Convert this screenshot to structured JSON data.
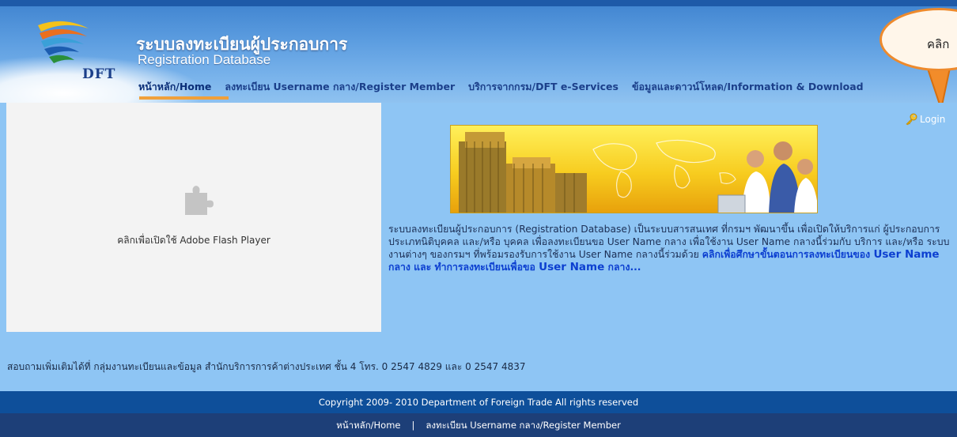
{
  "header": {
    "logo_text": "DFT",
    "title_th": "ระบบลงทะเบียนผู้ประกอบการ",
    "title_en": "Registration Database",
    "callout_text": "คลิก"
  },
  "nav": {
    "items": [
      {
        "label": "หน้าหลัก/Home"
      },
      {
        "label": "ลงทะเบียน Username กลาง/Register Member"
      },
      {
        "label": "บริการจากกรม/DFT e-Services"
      },
      {
        "label": "ข้อมูลและดาวน์โหลด/Information & Download"
      }
    ]
  },
  "main": {
    "flash_text": "คลิกเพื่อเปิดใช้ Adobe Flash Player",
    "login_label": "Login",
    "intro_text": "ระบบลงทะเบียนผู้ประกอบการ (Registration Database) เป็นระบบสารสนเทศ ที่กรมฯ พัฒนาขึ้น เพื่อเปิดให้บริการแก่ ผู้ประกอบการประเภทนิติบุคคล และ/หรือ บุคคล เพื่อลงทะเบียนขอ User Name กลาง เพื่อใช้งาน User Name กลางนี้ร่วมกับ บริการ และ/หรือ ระบบงานต่างๆ ของกรมฯ ที่พร้อมรองรับการใช้งาน User Name กลางนี้ร่วมด้วย ",
    "intro_link_1": "คลิกเพื่อศึกษาขั้นตอนการลงทะเบียนของ ",
    "intro_link_2": "User Name",
    "intro_link_3": " กลาง และ ทำการลงทะเบียนเพื่อขอ ",
    "intro_link_4": "User Name",
    "intro_link_5": " กลาง...",
    "contact_text": "สอบถามเพิ่มเติมได้ที่ กลุ่มงานทะเบียนและข้อมูล สำนักบริการการค้าต่างประเทศ ชั้น 4 โทร. 0 2547 4829 และ 0 2547 4837"
  },
  "footer": {
    "copyright": "Copyright 2009- 2010 Department of Foreign Trade All rights reserved",
    "links": [
      {
        "label": "หน้าหลัก/Home"
      },
      {
        "label": "ลงทะเบียน Username กลาง/Register Member"
      }
    ],
    "separator": "|"
  },
  "colors": {
    "header_blue": "#5c9de0",
    "main_blue": "#8ec5f4",
    "footer_blue": "#0e4f9a",
    "accent_orange": "#ee8a2c",
    "link_blue": "#0c3fd0"
  }
}
